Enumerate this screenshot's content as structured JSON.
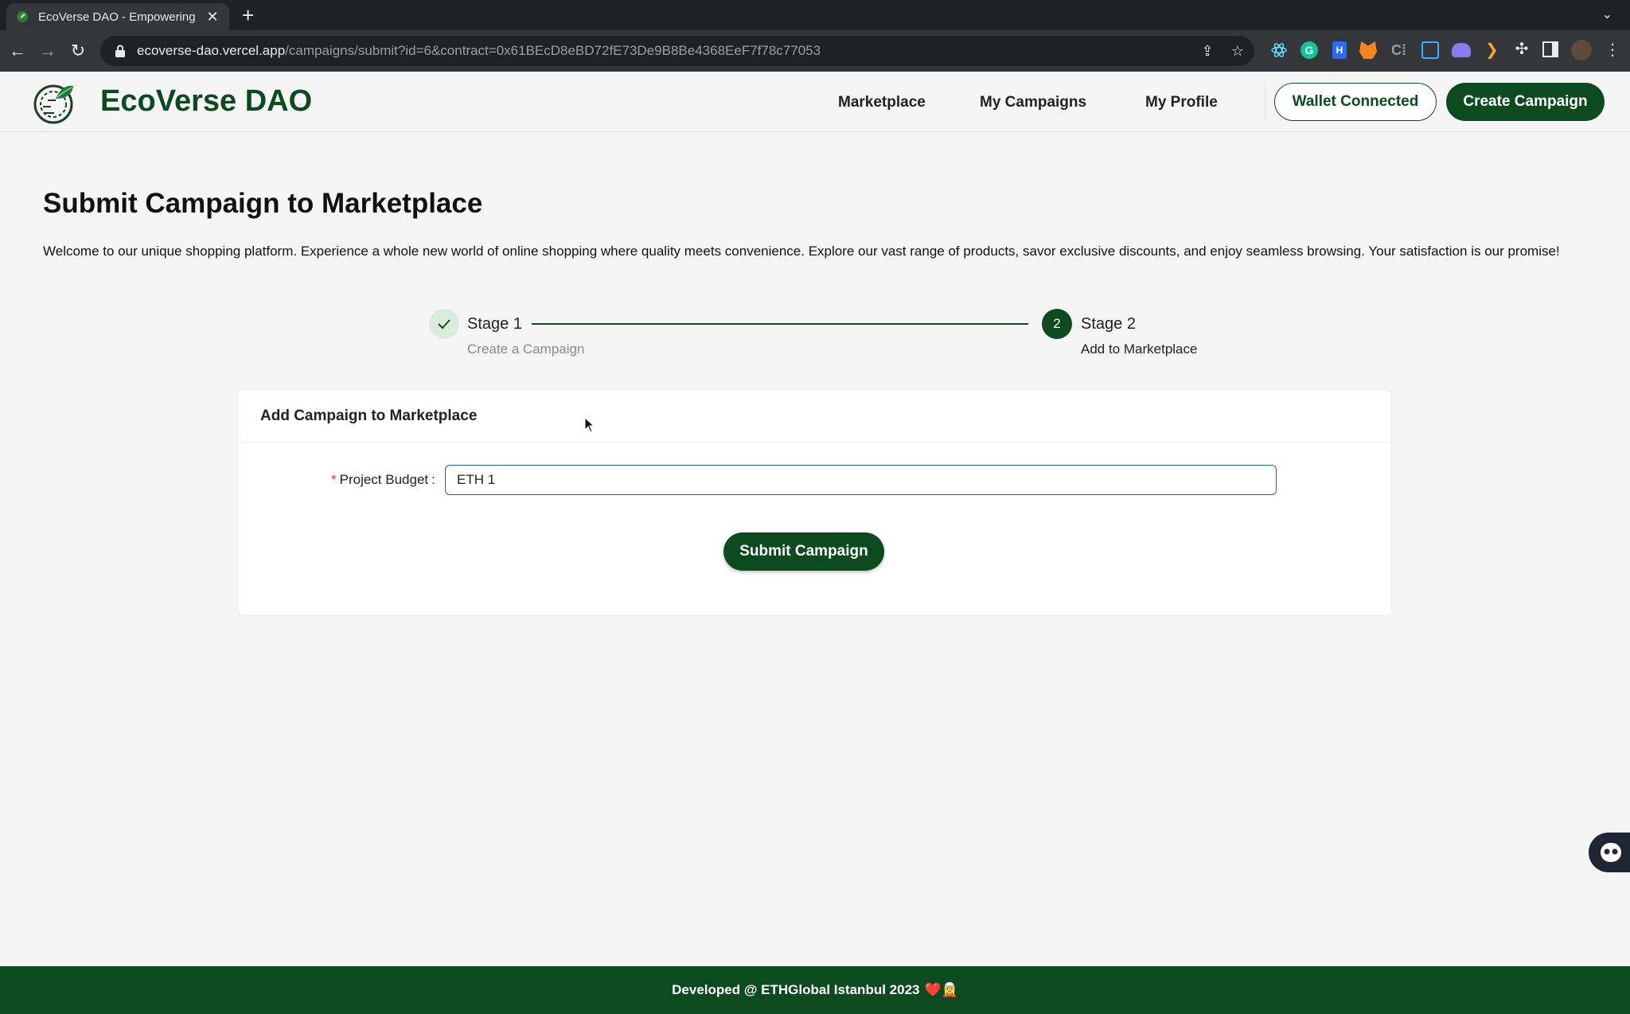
{
  "browser": {
    "tab_title": "EcoVerse DAO - Empowering E",
    "url_host": "ecoverse-dao.vercel.app",
    "url_path": "/campaigns/submit?id=6&contract=0x61BEcD8eBD72fE73De9B8Be4368EeF7f78c77053"
  },
  "header": {
    "brand": "EcoVerse DAO",
    "nav": [
      "Marketplace",
      "My Campaigns",
      "My Profile"
    ],
    "wallet_button": "Wallet Connected",
    "create_button": "Create Campaign"
  },
  "main": {
    "title": "Submit Campaign to Marketplace",
    "description": "Welcome to our unique shopping platform. Experience a whole new world of online shopping where quality meets convenience. Explore our vast range of products, savor exclusive discounts, and enjoy seamless browsing. Your satisfaction is our promise!",
    "steps": [
      {
        "number": "1",
        "title": "Stage 1",
        "subtitle": "Create a Campaign",
        "status": "done"
      },
      {
        "number": "2",
        "title": "Stage 2",
        "subtitle": "Add to Marketplace",
        "status": "active"
      }
    ],
    "card": {
      "title": "Add Campaign to Marketplace",
      "field_label": "Project Budget",
      "field_colon": ":",
      "field_value": "ETH 1",
      "submit_label": "Submit Campaign"
    }
  },
  "footer": {
    "text": "Developed @ ETHGlobal Istanbul 2023",
    "emoji": "❤️🧝"
  },
  "colors": {
    "brand_green": "#0e4a20",
    "input_focus": "#1f5fbf"
  }
}
